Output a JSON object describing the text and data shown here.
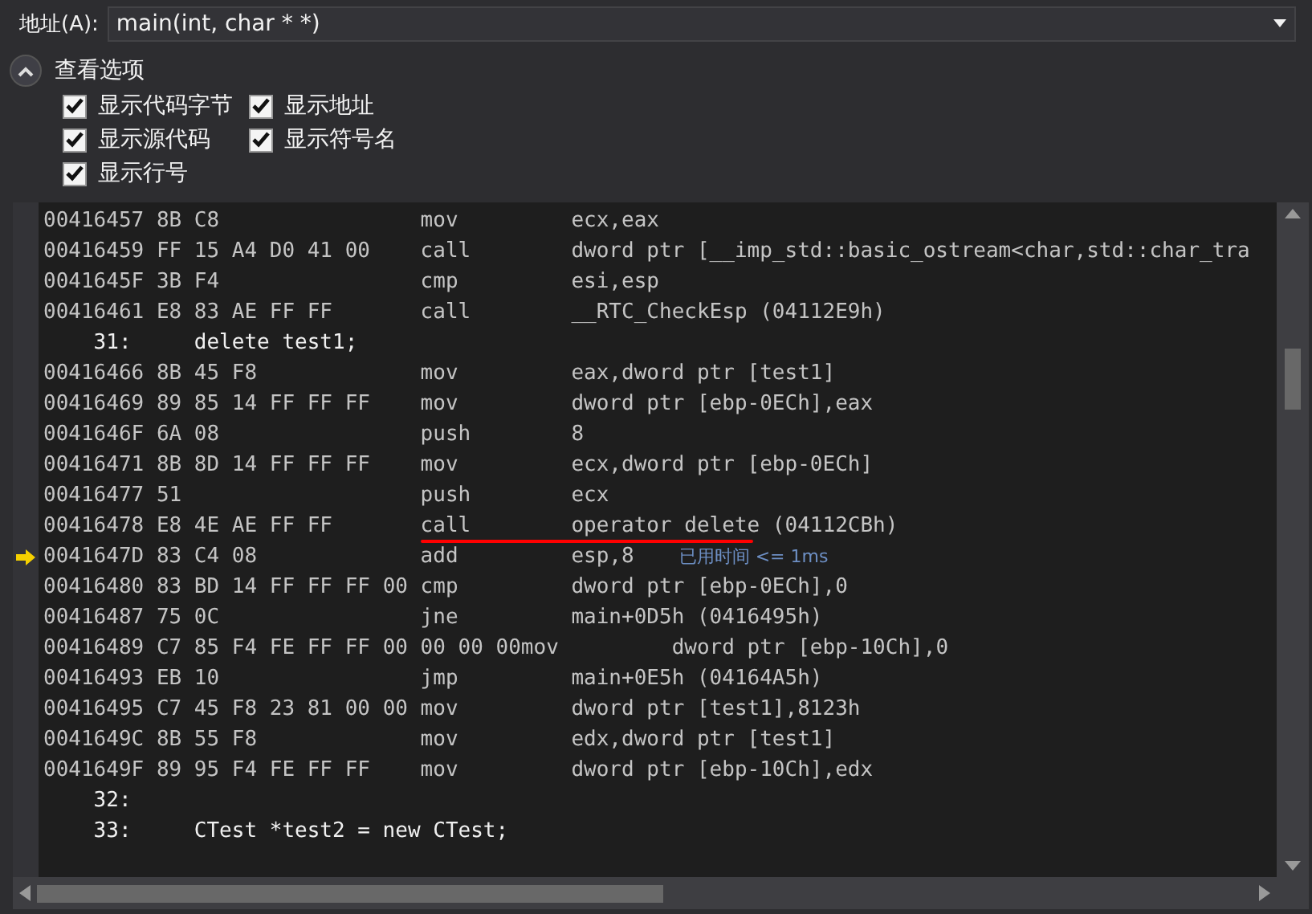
{
  "address_bar": {
    "label": "地址(A):",
    "value": "main(int, char * *)"
  },
  "view_options": {
    "title": "查看选项",
    "expanded": true,
    "items": [
      {
        "label": "显示代码字节",
        "checked": true
      },
      {
        "label": "显示地址",
        "checked": true
      },
      {
        "label": "显示源代码",
        "checked": true
      },
      {
        "label": "显示符号名",
        "checked": true
      },
      {
        "label": "显示行号",
        "checked": true
      }
    ]
  },
  "disassembly": [
    {
      "kind": "asm",
      "address": "00416457",
      "bytes": "8B C8",
      "mnemonic": "mov",
      "operands": "ecx,eax",
      "current": false,
      "underlined": false
    },
    {
      "kind": "asm",
      "address": "00416459",
      "bytes": "FF 15 A4 D0 41 00",
      "mnemonic": "call",
      "operands": "dword ptr [__imp_std::basic_ostream<char,std::char_tra",
      "current": false,
      "underlined": false
    },
    {
      "kind": "asm",
      "address": "0041645F",
      "bytes": "3B F4",
      "mnemonic": "cmp",
      "operands": "esi,esp",
      "current": false,
      "underlined": false
    },
    {
      "kind": "asm",
      "address": "00416461",
      "bytes": "E8 83 AE FF FF",
      "mnemonic": "call",
      "operands": "__RTC_CheckEsp (04112E9h)",
      "current": false,
      "underlined": false
    },
    {
      "kind": "source",
      "line": "31:",
      "code": "delete test1;"
    },
    {
      "kind": "asm",
      "address": "00416466",
      "bytes": "8B 45 F8",
      "mnemonic": "mov",
      "operands": "eax,dword ptr [test1]",
      "current": false,
      "underlined": false
    },
    {
      "kind": "asm",
      "address": "00416469",
      "bytes": "89 85 14 FF FF FF",
      "mnemonic": "mov",
      "operands": "dword ptr [ebp-0ECh],eax",
      "current": false,
      "underlined": false
    },
    {
      "kind": "asm",
      "address": "0041646F",
      "bytes": "6A 08",
      "mnemonic": "push",
      "operands": "8",
      "current": false,
      "underlined": false
    },
    {
      "kind": "asm",
      "address": "00416471",
      "bytes": "8B 8D 14 FF FF FF",
      "mnemonic": "mov",
      "operands": "ecx,dword ptr [ebp-0ECh]",
      "current": false,
      "underlined": false
    },
    {
      "kind": "asm",
      "address": "00416477",
      "bytes": "51",
      "mnemonic": "push",
      "operands": "ecx",
      "current": false,
      "underlined": false
    },
    {
      "kind": "asm",
      "address": "00416478",
      "bytes": "E8 4E AE FF FF",
      "mnemonic": "call",
      "operands": "operator delete (04112CBh)",
      "current": false,
      "underlined": true
    },
    {
      "kind": "asm",
      "address": "0041647D",
      "bytes": "83 C4 08",
      "mnemonic": "add",
      "operands": "esp,8",
      "current": true,
      "underlined": false,
      "perf_tip": "已用时间 <= 1ms"
    },
    {
      "kind": "asm",
      "address": "00416480",
      "bytes": "83 BD 14 FF FF FF 00",
      "mnemonic": "cmp",
      "operands": "dword ptr [ebp-0ECh],0",
      "current": false,
      "underlined": false
    },
    {
      "kind": "asm",
      "address": "00416487",
      "bytes": "75 0C",
      "mnemonic": "jne",
      "operands": "main+0D5h (0416495h)",
      "current": false,
      "underlined": false
    },
    {
      "kind": "asm",
      "address": "00416489",
      "bytes": "C7 85 F4 FE FF FF 00 00 00 00",
      "mnemonic": "mov",
      "operands": "dword ptr [ebp-10Ch],0",
      "current": false,
      "underlined": false
    },
    {
      "kind": "asm",
      "address": "00416493",
      "bytes": "EB 10",
      "mnemonic": "jmp",
      "operands": "main+0E5h (04164A5h)",
      "current": false,
      "underlined": false
    },
    {
      "kind": "asm",
      "address": "00416495",
      "bytes": "C7 45 F8 23 81 00 00",
      "mnemonic": "mov",
      "operands": "dword ptr [test1],8123h",
      "current": false,
      "underlined": false
    },
    {
      "kind": "asm",
      "address": "0041649C",
      "bytes": "8B 55 F8",
      "mnemonic": "mov",
      "operands": "edx,dword ptr [test1]",
      "current": false,
      "underlined": false
    },
    {
      "kind": "asm",
      "address": "0041649F",
      "bytes": "89 95 F4 FE FF FF",
      "mnemonic": "mov",
      "operands": "dword ptr [ebp-10Ch],edx",
      "current": false,
      "underlined": false
    },
    {
      "kind": "source",
      "line": "32:"
    },
    {
      "kind": "source",
      "line": "33:",
      "code": "CTest *test2 = new CTest;"
    }
  ]
}
